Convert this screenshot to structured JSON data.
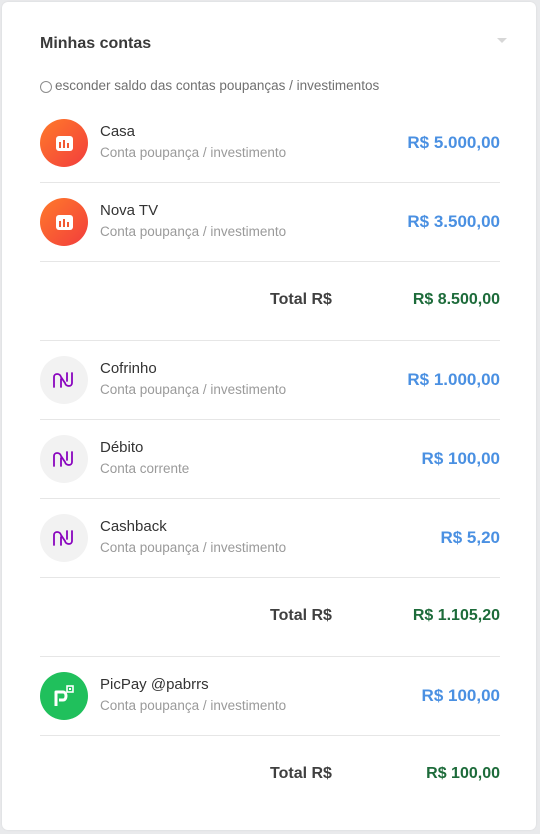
{
  "panel": {
    "title": "Minhas contas",
    "hide_savings_label": "esconder saldo das contas poupanças / investimentos"
  },
  "groups": [
    {
      "bank": "inter",
      "accounts": [
        {
          "name": "Casa",
          "type": "Conta poupança / investimento",
          "value": "R$ 5.000,00"
        },
        {
          "name": "Nova TV",
          "type": "Conta poupança / investimento",
          "value": "R$ 3.500,00"
        }
      ],
      "total_label": "Total R$",
      "total_value": "R$ 8.500,00"
    },
    {
      "bank": "nubank",
      "accounts": [
        {
          "name": "Cofrinho",
          "type": "Conta poupança / investimento",
          "value": "R$ 1.000,00"
        },
        {
          "name": "Débito",
          "type": "Conta corrente",
          "value": "R$ 100,00"
        },
        {
          "name": "Cashback",
          "type": "Conta poupança / investimento",
          "value": "R$ 5,20"
        }
      ],
      "total_label": "Total R$",
      "total_value": "R$ 1.105,20"
    },
    {
      "bank": "picpay",
      "accounts": [
        {
          "name": "PicPay @pabrrs",
          "type": "Conta poupança / investimento",
          "value": "R$ 100,00"
        }
      ],
      "total_label": "Total R$",
      "total_value": "R$ 100,00"
    }
  ],
  "colors": {
    "value_blue": "#4a90e2",
    "total_green": "#1d6b3a",
    "inter_orange": "#ff7a2a",
    "nubank_purple": "#8a05be",
    "picpay_green": "#20c05c"
  },
  "icons": {
    "inter": "inter-bank-icon",
    "nubank": "nubank-icon",
    "picpay": "picpay-icon",
    "collapse": "collapse-caret-icon"
  }
}
